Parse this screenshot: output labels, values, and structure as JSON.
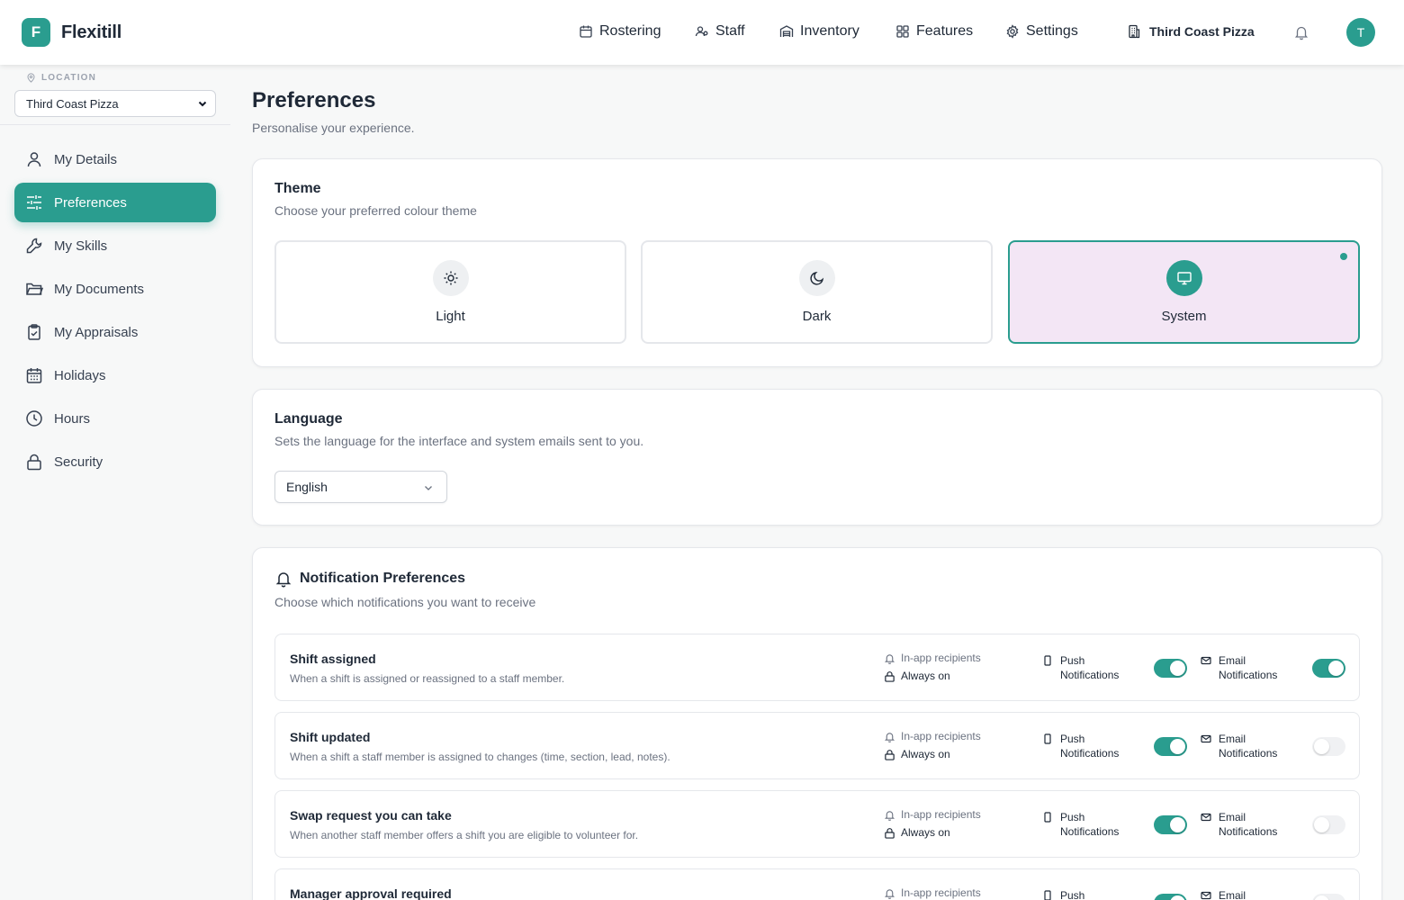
{
  "app": {
    "logo_letter": "F",
    "name": "Flexitill"
  },
  "nav": [
    {
      "label": "Rostering",
      "icon": "calendar-icon"
    },
    {
      "label": "Staff",
      "icon": "users-icon"
    },
    {
      "label": "Inventory",
      "icon": "warehouse-icon"
    },
    {
      "label": "Features",
      "icon": "grid-icon"
    },
    {
      "label": "Settings",
      "icon": "gear-icon"
    }
  ],
  "header": {
    "location": "Third Coast Pizza",
    "avatar_initial": "T"
  },
  "sidebar": {
    "location_label": "LOCATION",
    "location_value": "Third Coast Pizza",
    "items": [
      {
        "label": "My Details",
        "icon": "user-icon"
      },
      {
        "label": "Preferences",
        "icon": "sliders-icon",
        "active": true
      },
      {
        "label": "My Skills",
        "icon": "wrench-icon"
      },
      {
        "label": "My Documents",
        "icon": "folder-icon"
      },
      {
        "label": "My Appraisals",
        "icon": "clipboard-icon"
      },
      {
        "label": "Holidays",
        "icon": "calendar-icon"
      },
      {
        "label": "Hours",
        "icon": "clock-icon"
      },
      {
        "label": "Security",
        "icon": "lock-icon"
      }
    ]
  },
  "page": {
    "title": "Preferences",
    "subtitle": "Personalise your experience."
  },
  "theme": {
    "title": "Theme",
    "subtitle": "Choose your preferred colour theme",
    "options": [
      {
        "label": "Light",
        "icon": "sun-icon"
      },
      {
        "label": "Dark",
        "icon": "moon-icon"
      },
      {
        "label": "System",
        "icon": "monitor-icon",
        "selected": true
      }
    ]
  },
  "language": {
    "title": "Language",
    "subtitle": "Sets the language for the interface and system emails sent to you.",
    "value": "English"
  },
  "notifications": {
    "title": "Notification Preferences",
    "subtitle": "Choose which notifications you want to receive",
    "inapp_label": "In-app recipients",
    "always_on": "Always on",
    "push_line1": "Push",
    "push_line2": "Notifications",
    "email_line1": "Email",
    "email_line2": "Notifications",
    "rows": [
      {
        "title": "Shift assigned",
        "desc": "When a shift is assigned or reassigned to a staff member.",
        "push": true,
        "email": true
      },
      {
        "title": "Shift updated",
        "desc": "When a shift a staff member is assigned to changes (time, section, lead, notes).",
        "push": true,
        "email": false
      },
      {
        "title": "Swap request you can take",
        "desc": "When another staff member offers a shift you are eligible to volunteer for.",
        "push": true,
        "email": false
      },
      {
        "title": "Manager approval required",
        "desc": "",
        "push": true,
        "email": false
      }
    ]
  },
  "colors": {
    "accent": "#2a9d8f",
    "selected_bg": "#f3e6f5"
  }
}
